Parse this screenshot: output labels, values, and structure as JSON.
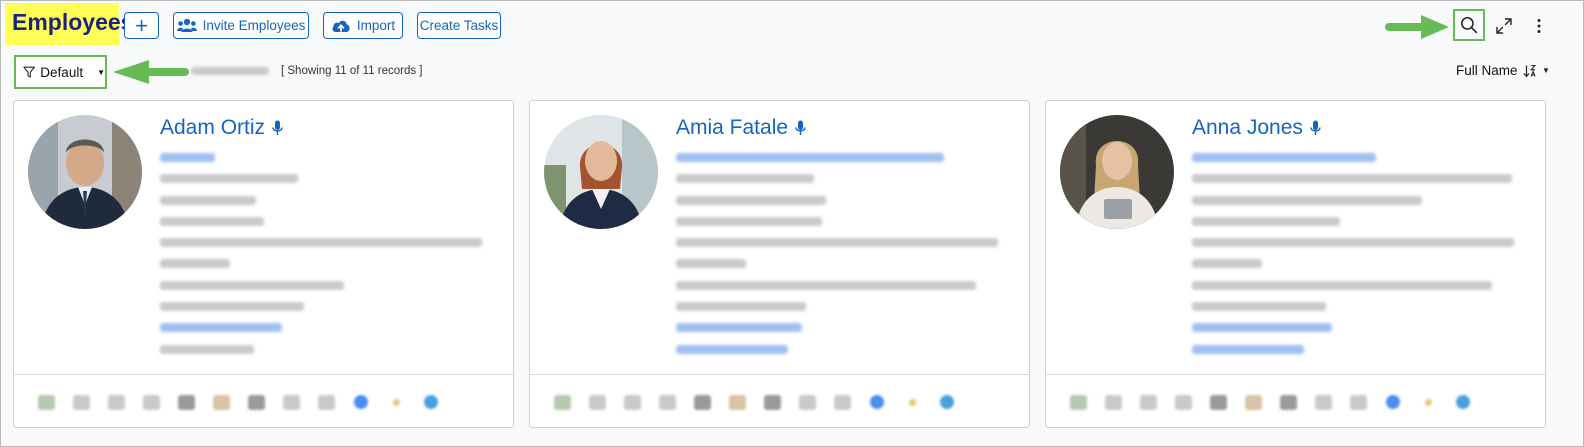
{
  "header": {
    "title": "Employees",
    "add_label": "+",
    "invite_label": "Invite Employees",
    "import_label": "Import",
    "create_tasks_label": "Create Tasks"
  },
  "filter": {
    "label": "Default",
    "records_text": "[ Showing 11 of 11 records ]"
  },
  "sort": {
    "label": "Full Name",
    "direction_icon": "sort-ascending-icon"
  },
  "employees": [
    {
      "name": "Adam Ortiz"
    },
    {
      "name": "Amia Fatale"
    },
    {
      "name": "Anna Jones"
    }
  ],
  "colors": {
    "accent": "#1565c0",
    "title": "#1a237e",
    "highlight": "#ffff55",
    "annotation_green": "#66bb55"
  }
}
